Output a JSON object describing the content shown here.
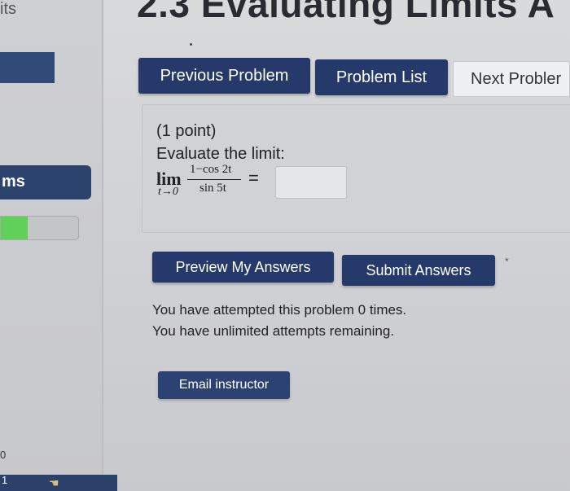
{
  "sidebar": {
    "title": "its",
    "link_label": "ms",
    "progress_fraction": 0.35,
    "bottom_number": "1",
    "bottom_zero": "0"
  },
  "page": {
    "title": "2.3 Evaluating Limits A"
  },
  "nav": {
    "previous_label": "Previous Problem",
    "list_label": "Problem List",
    "next_label": "Next Probler"
  },
  "problem": {
    "points": "(1 point)",
    "instruction": "Evaluate the limit:",
    "lim_word": "lim",
    "lim_subscript": "t→0",
    "numerator": "1−cos 2t",
    "denominator": "sin 5t",
    "equals": "=",
    "answer_value": ""
  },
  "actions": {
    "preview_label": "Preview My Answers",
    "submit_label": "Submit Answers",
    "marker": "*"
  },
  "status": {
    "attempts_line": "You have attempted this problem 0 times.",
    "remaining_line": "You have unlimited attempts remaining."
  },
  "email": {
    "label": "Email instructor"
  },
  "colors": {
    "button_dark": "#25396a",
    "progress_green": "#5fd05a"
  },
  "icons": {
    "cursor": "hand-cursor-icon"
  }
}
